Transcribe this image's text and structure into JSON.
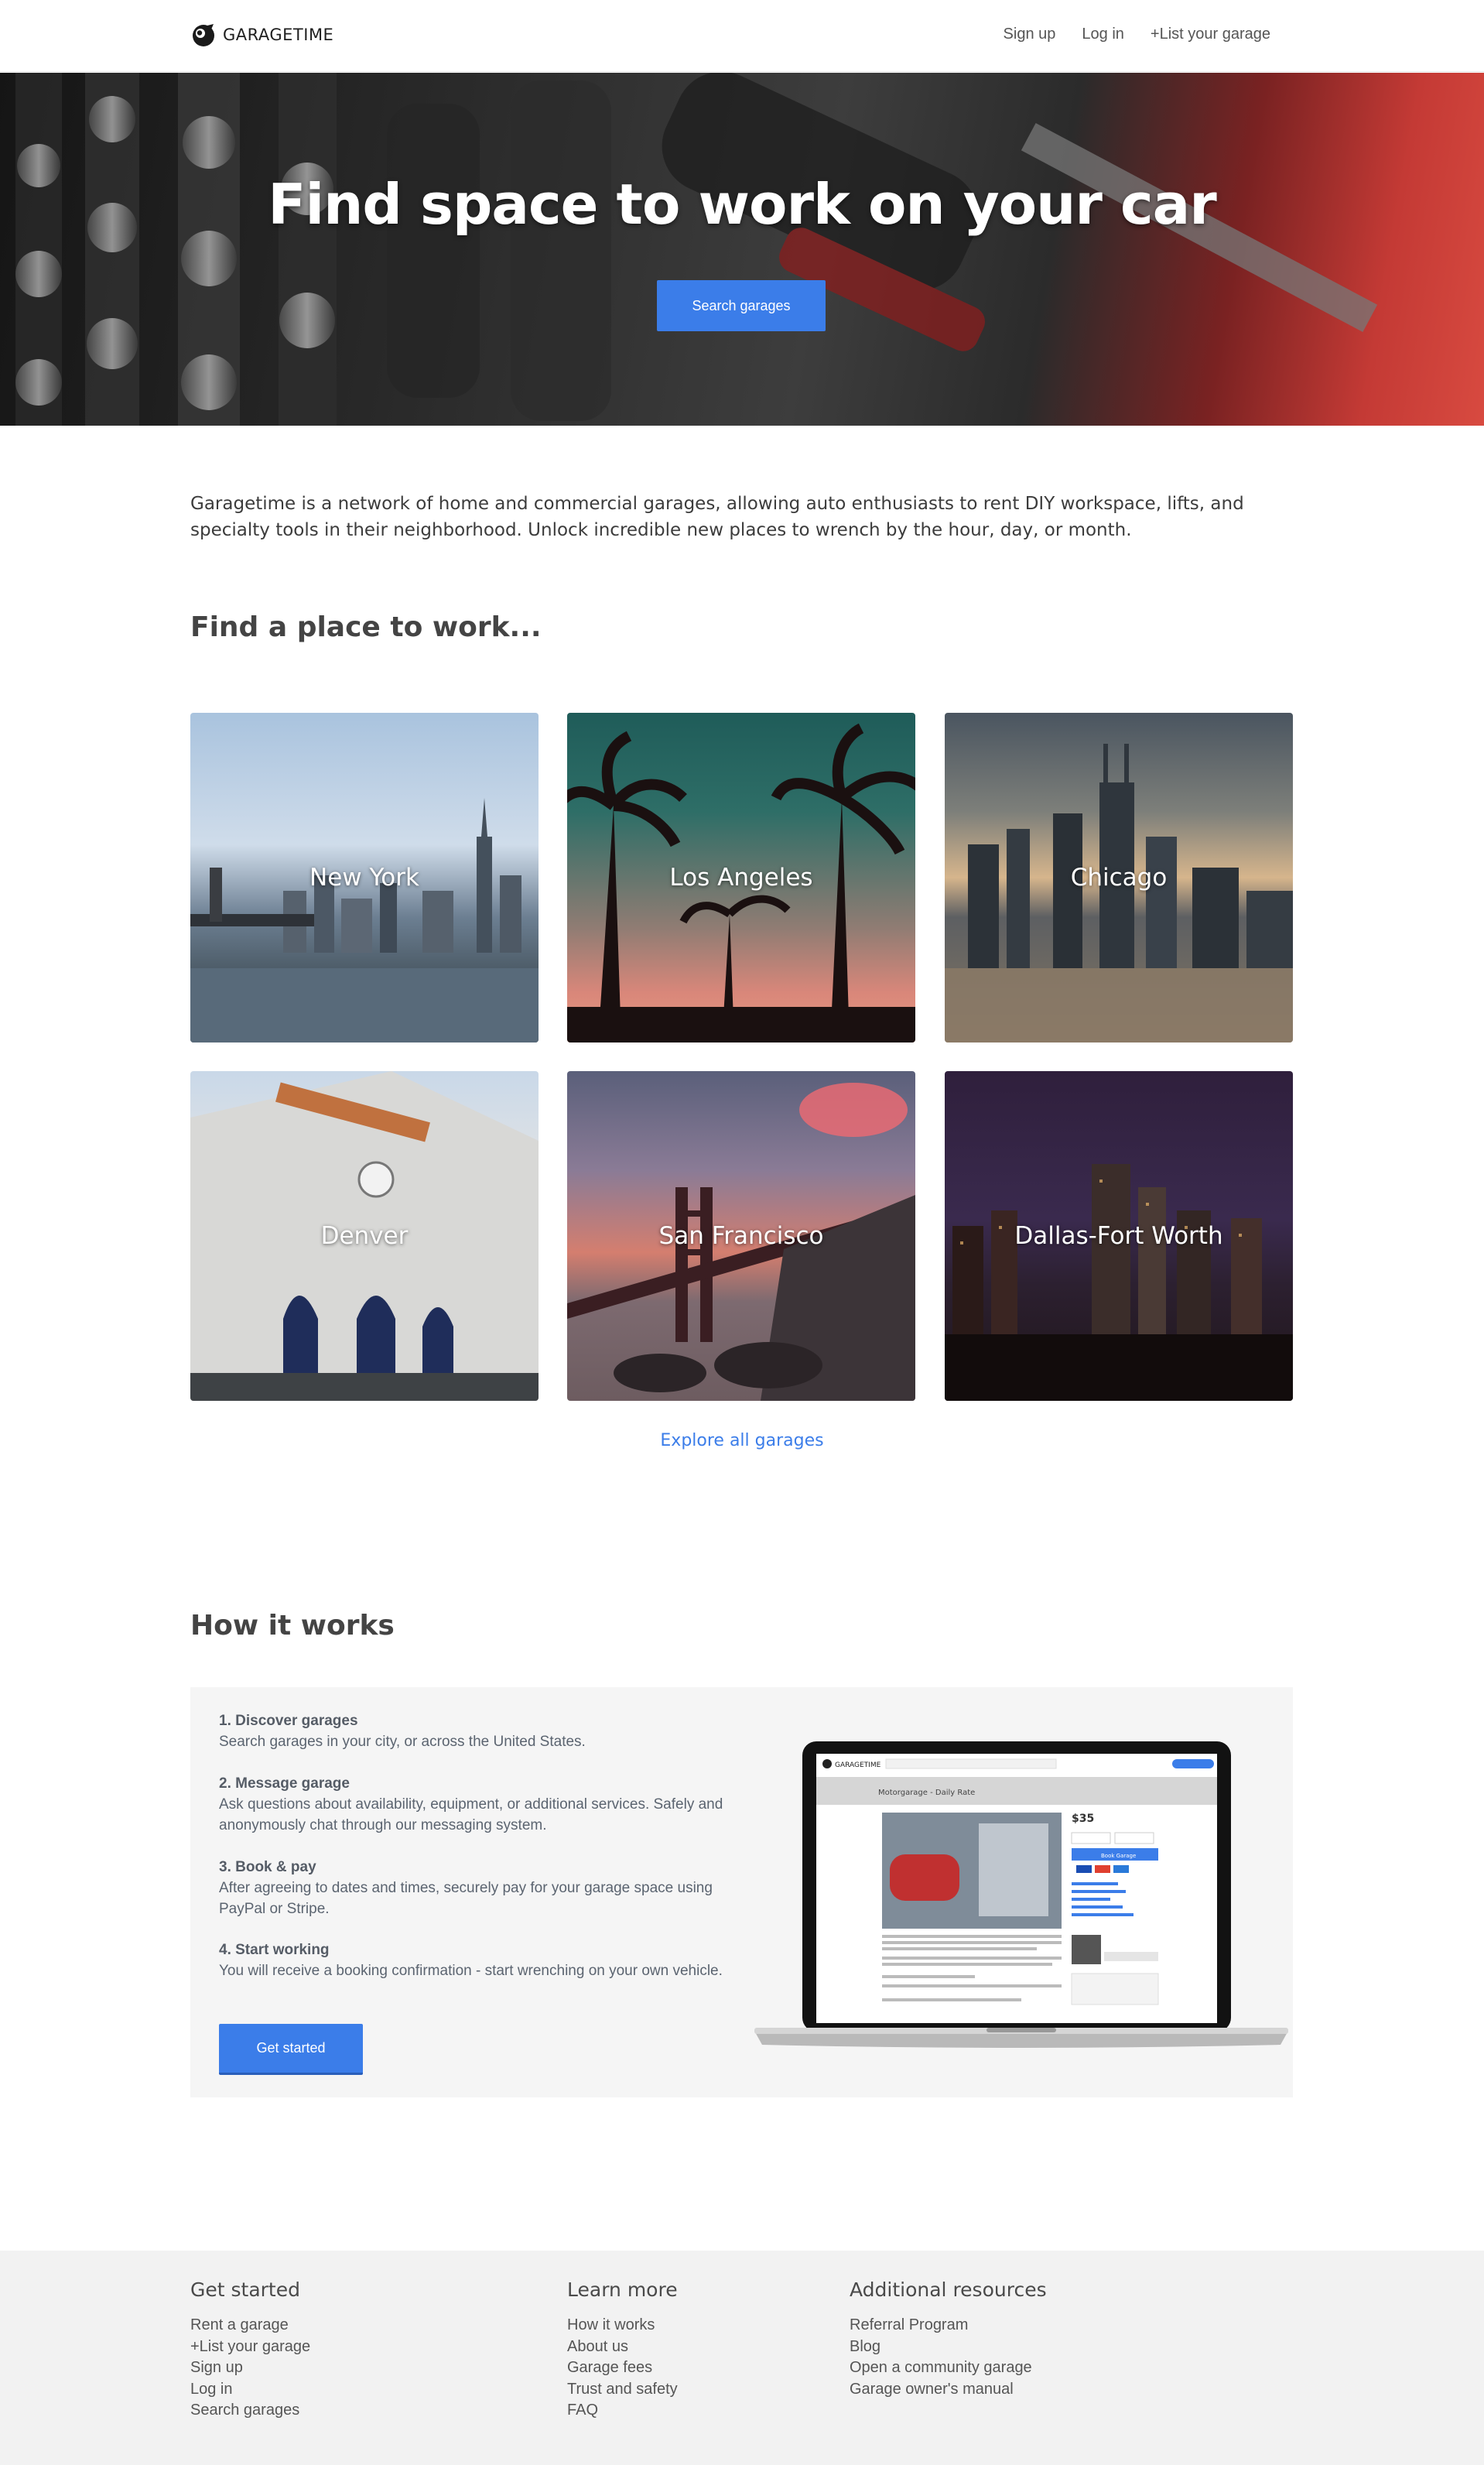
{
  "header": {
    "brand": "GARAGETIME",
    "nav": [
      "Sign up",
      "Log in",
      "+List your garage"
    ]
  },
  "hero": {
    "title": "Find space to work on your car",
    "button": "Search garages"
  },
  "intro": "Garagetime is a network of home and commercial garages, allowing auto enthusiasts to rent DIY workspace, lifts, and specialty tools in their neighborhood. Unlock incredible new places to wrench by the hour, day, or month.",
  "find": {
    "title": "Find a place to work...",
    "cities": [
      "New York",
      "Los Angeles",
      "Chicago",
      "Denver",
      "San Francisco",
      "Dallas-Fort Worth"
    ],
    "explore": "Explore all garages"
  },
  "how": {
    "title": "How it works",
    "steps": [
      {
        "title": "1. Discover garages",
        "text": "Search garages in your city, or across the United States."
      },
      {
        "title": "2. Message garage",
        "text": "Ask questions about availability, equipment, or additional services. Safely and anonymously chat through our messaging system."
      },
      {
        "title": "3. Book & pay",
        "text": "After agreeing to dates and times, securely pay for your garage space using PayPal or Stripe."
      },
      {
        "title": "4. Start working",
        "text": "You will receive a booking confirmation - start wrenching on your own vehicle."
      }
    ],
    "cta": "Get started",
    "laptop": {
      "brand": "GARAGETIME",
      "listing_title": "Motorgarage - Daily Rate",
      "price": "$35",
      "book": "Book Garage"
    }
  },
  "footer": {
    "columns": [
      {
        "heading": "Get started",
        "links": [
          "Rent a garage",
          "+List your garage",
          "Sign up",
          "Log in",
          "Search garages"
        ]
      },
      {
        "heading": "Learn more",
        "links": [
          "How it works",
          "About us",
          "Garage fees",
          "Trust and safety",
          "FAQ"
        ]
      },
      {
        "heading": "Additional resources",
        "links": [
          "Referral Program",
          "Blog",
          "Open a community garage",
          "Garage owner's manual"
        ]
      }
    ]
  },
  "colors": {
    "accent": "#3b7de9",
    "footer_bg": "#f2f2f2",
    "how_bg": "#f5f5f5"
  }
}
